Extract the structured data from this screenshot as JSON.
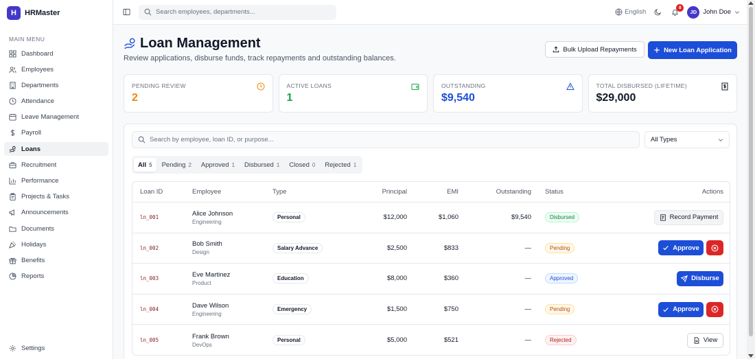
{
  "app": {
    "logo_letter": "H",
    "name": "HRMaster"
  },
  "sidebar": {
    "section": "MAIN MENU",
    "items": [
      {
        "label": "Dashboard",
        "icon": "grid-icon"
      },
      {
        "label": "Employees",
        "icon": "users-icon"
      },
      {
        "label": "Departments",
        "icon": "building-icon"
      },
      {
        "label": "Attendance",
        "icon": "clock-icon"
      },
      {
        "label": "Leave Management",
        "icon": "calendar-icon"
      },
      {
        "label": "Payroll",
        "icon": "dollar-icon"
      },
      {
        "label": "Loans",
        "icon": "hand-coins-icon",
        "active": true
      },
      {
        "label": "Recruitment",
        "icon": "briefcase-icon"
      },
      {
        "label": "Performance",
        "icon": "bar-chart-icon"
      },
      {
        "label": "Projects & Tasks",
        "icon": "clipboard-icon"
      },
      {
        "label": "Announcements",
        "icon": "megaphone-icon"
      },
      {
        "label": "Documents",
        "icon": "folder-icon"
      },
      {
        "label": "Holidays",
        "icon": "party-popper-icon"
      },
      {
        "label": "Benefits",
        "icon": "gift-icon"
      },
      {
        "label": "Reports",
        "icon": "pie-chart-icon"
      }
    ],
    "settings": "Settings"
  },
  "topbar": {
    "search_placeholder": "Search employees, departments...",
    "language": "English",
    "notification_count": "8",
    "user_initials": "JD",
    "user_name": "John Doe"
  },
  "page": {
    "title": "Loan Management",
    "subtitle": "Review applications, disburse funds, track repayments and outstanding balances.",
    "bulk_upload_label": "Bulk Upload Repayments",
    "new_loan_label": "New Loan Application"
  },
  "stats": [
    {
      "label": "PENDING REVIEW",
      "value": "2",
      "color": "#ea8a0c",
      "icon": "clock-icon"
    },
    {
      "label": "ACTIVE LOANS",
      "value": "1",
      "color": "#16a34a",
      "icon": "wallet-icon"
    },
    {
      "label": "OUTSTANDING",
      "value": "$9,540",
      "color": "#1d4ed8",
      "icon": "alert-triangle-icon"
    },
    {
      "label": "TOTAL DISBURSED (LIFETIME)",
      "value": "$29,000",
      "color": "#111827",
      "icon": "receipt-icon"
    }
  ],
  "filters": {
    "search_placeholder": "Search by employee, loan ID, or purpose...",
    "type_select": "All Types"
  },
  "tabs": [
    {
      "label": "All",
      "count": "5",
      "active": true
    },
    {
      "label": "Pending",
      "count": "2"
    },
    {
      "label": "Approved",
      "count": "1"
    },
    {
      "label": "Disbursed",
      "count": "1"
    },
    {
      "label": "Closed",
      "count": "0"
    },
    {
      "label": "Rejected",
      "count": "1"
    }
  ],
  "table": {
    "headers": {
      "loan_id": "Loan ID",
      "employee": "Employee",
      "type": "Type",
      "principal": "Principal",
      "emi": "EMI",
      "outstanding": "Outstanding",
      "status": "Status",
      "actions": "Actions"
    },
    "rows": [
      {
        "id": "ln_001",
        "name": "Alice Johnson",
        "dept": "Engineering",
        "type": "Personal",
        "principal": "$12,000",
        "emi": "$1,060",
        "outstanding": "$9,540",
        "status": "Disbursed",
        "action": "Record Payment"
      },
      {
        "id": "ln_002",
        "name": "Bob Smith",
        "dept": "Design",
        "type": "Salary Advance",
        "principal": "$2,500",
        "emi": "$833",
        "outstanding": "—",
        "status": "Pending",
        "action": "Approve"
      },
      {
        "id": "ln_003",
        "name": "Eve Martinez",
        "dept": "Product",
        "type": "Education",
        "principal": "$8,000",
        "emi": "$360",
        "outstanding": "—",
        "status": "Approved",
        "action": "Disburse"
      },
      {
        "id": "ln_004",
        "name": "Dave Wilson",
        "dept": "Engineering",
        "type": "Emergency",
        "principal": "$1,500",
        "emi": "$750",
        "outstanding": "—",
        "status": "Pending",
        "action": "Approve"
      },
      {
        "id": "ln_005",
        "name": "Frank Brown",
        "dept": "DevOps",
        "type": "Personal",
        "principal": "$5,000",
        "emi": "$521",
        "outstanding": "—",
        "status": "Rejected",
        "action": "View"
      }
    ]
  },
  "colors": {
    "primary": "#1d4ed8",
    "brand": "#4338ca",
    "danger": "#dc2626"
  }
}
